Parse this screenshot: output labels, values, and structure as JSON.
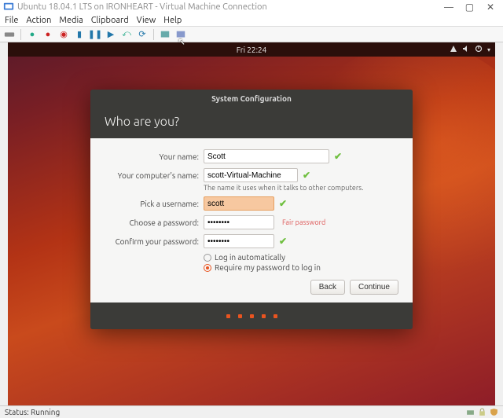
{
  "host": {
    "title": "Ubuntu 18.04.1 LTS on IRONHEART - Virtual Machine Connection",
    "menu": [
      "File",
      "Action",
      "Media",
      "Clipboard",
      "View",
      "Help"
    ],
    "status_label": "Status: Running"
  },
  "gnome": {
    "clock": "Fri 22:24"
  },
  "installer": {
    "window_title": "System Configuration",
    "heading": "Who are you?",
    "labels": {
      "name": "Your name:",
      "computer": "Your computer's name:",
      "computer_hint": "The name it uses when it talks to other computers.",
      "username": "Pick a username:",
      "password": "Choose a password:",
      "confirm": "Confirm your password:"
    },
    "values": {
      "name": "Scott",
      "computer": "scott-Virtual-Machine",
      "username": "scott",
      "password": "••••••••",
      "confirm": "••••••••"
    },
    "password_rating": "Fair password",
    "login_options": {
      "auto": "Log in automatically",
      "require": "Require my password to log in",
      "selected": "require"
    },
    "buttons": {
      "back": "Back",
      "continue": "Continue"
    }
  }
}
